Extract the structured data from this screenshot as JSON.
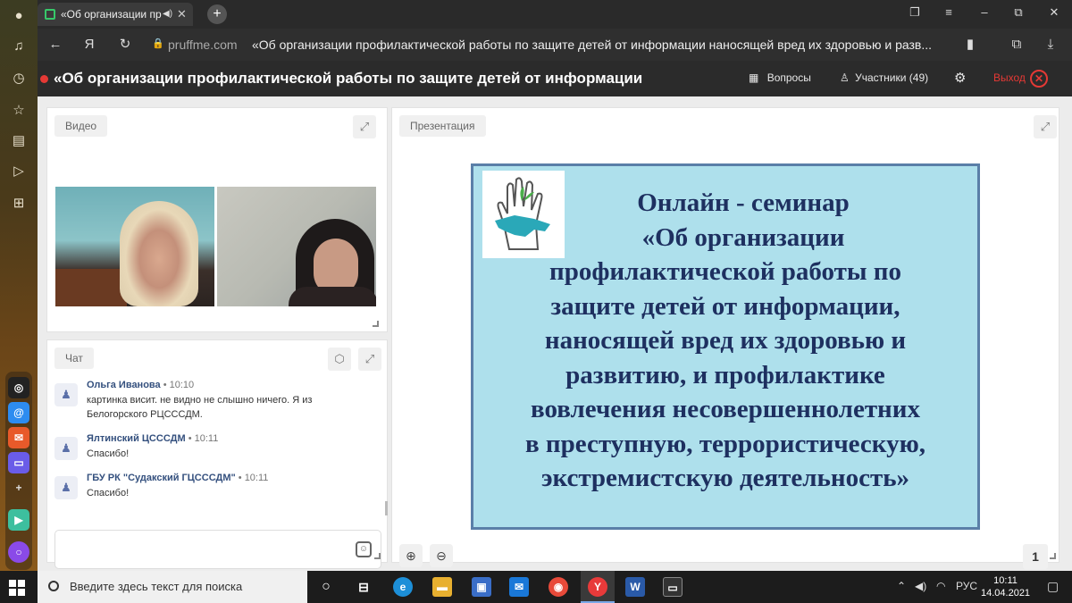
{
  "browser": {
    "tab_title": "«Об организации пр",
    "host": "pruffme.com",
    "url_title": "«Об организации профилактической работы по защите детей от информации наносящей вред их здоровью и разв..."
  },
  "header": {
    "title": "«Об организации профилактической работы по защите детей от информации",
    "questions_label": "Вопросы",
    "participants_label": "Участники (49)",
    "exit_label": "Выход"
  },
  "video_panel": {
    "label": "Видео"
  },
  "chat_panel": {
    "label": "Чат",
    "messages": [
      {
        "author": "Ольга Иванова",
        "time": "• 10:10",
        "text": "картинка висит. не видно не слышно ничего. Я из Белогорского РЦСССДМ."
      },
      {
        "author": "Ялтинский ЦСССДМ",
        "time": "• 10:11",
        "text": "Спасибо!"
      },
      {
        "author": "ГБУ РК \"Судакский ГЦСССДМ\"",
        "time": "• 10:11",
        "text": "Спасибо!"
      }
    ],
    "input_placeholder": ""
  },
  "presentation_panel": {
    "label": "Презентация",
    "slide_lines": [
      "Онлайн - семинар",
      "«Об организации",
      "профилактической работы по",
      "защите детей от информации,",
      "наносящей вред их здоровью и",
      "развитию, и профилактике",
      "вовлечения несовершеннолетних",
      "в преступную, террористическую,",
      "экстремистскую деятельность»"
    ],
    "page_number": "1"
  },
  "taskbar": {
    "search_placeholder": "Введите здесь текст для поиска",
    "language": "РУС",
    "time": "10:11",
    "date": "14.04.2021"
  },
  "colors": {
    "accent_red": "#e53935",
    "header_bg": "#2b2b2b",
    "slide_bg": "#aee0ec",
    "slide_text": "#1e3060"
  }
}
